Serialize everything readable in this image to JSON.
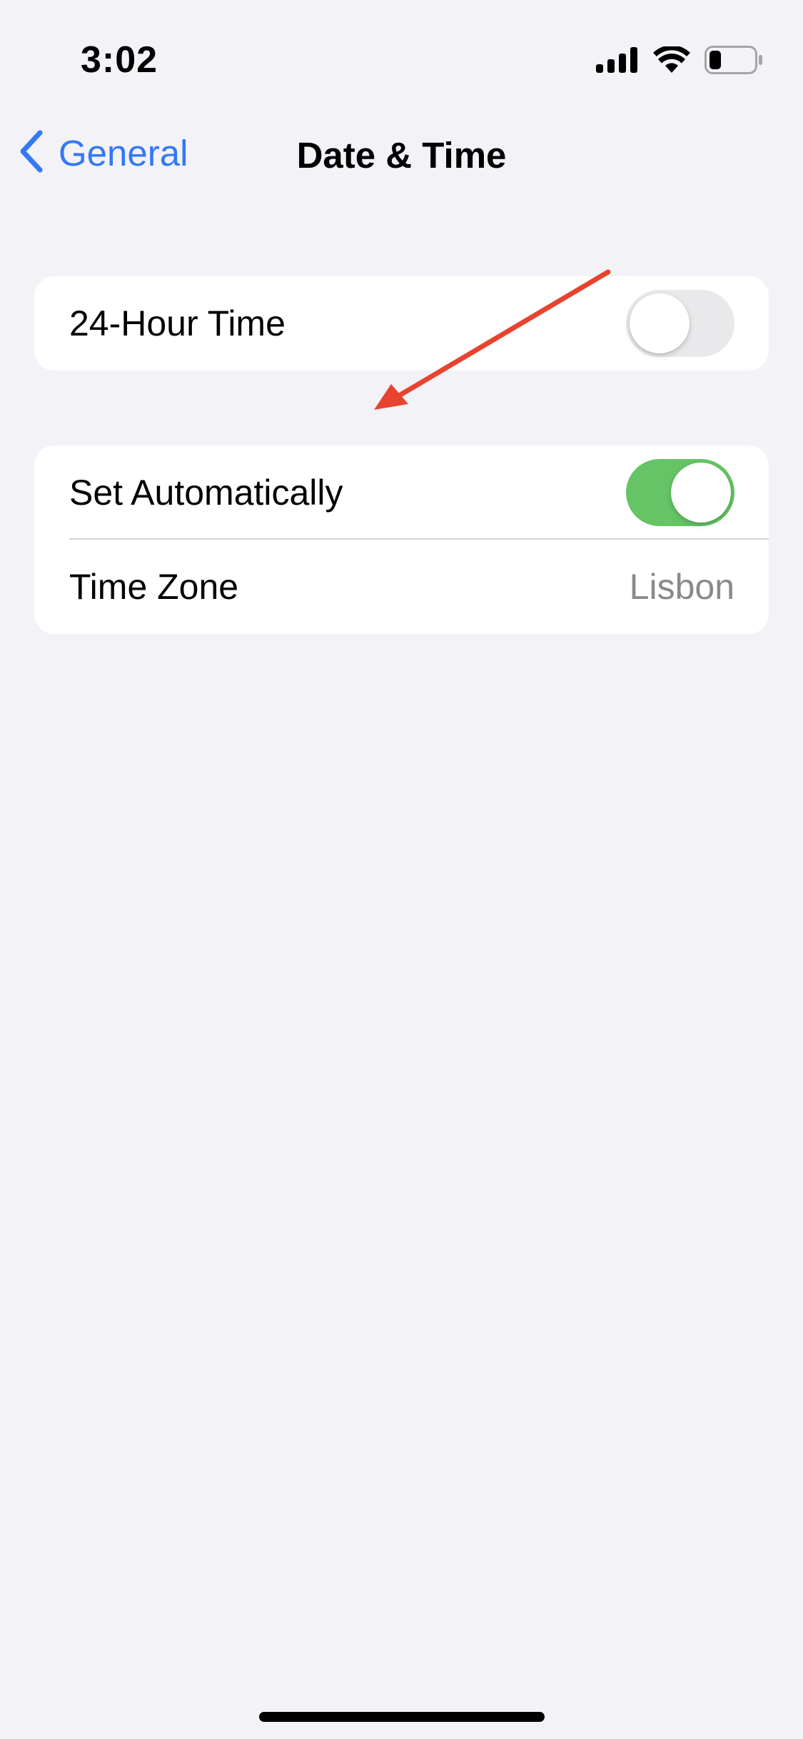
{
  "status_bar": {
    "time": "3:02",
    "icons": [
      "cellular-signal-icon",
      "wifi-icon",
      "battery-icon"
    ],
    "battery_level": 0.25
  },
  "nav": {
    "back_label": "General",
    "back_icon": "chevron-left-icon",
    "title": "Date & Time"
  },
  "settings": {
    "hour_24": {
      "label": "24-Hour Time",
      "enabled": false
    },
    "set_automatically": {
      "label": "Set Automatically",
      "enabled": true
    },
    "time_zone": {
      "label": "Time Zone",
      "value": "Lisbon"
    }
  },
  "annotation": {
    "type": "arrow",
    "color": "#E8432E"
  },
  "colors": {
    "accent": "#3478F6",
    "toggle_on": "#65C466",
    "toggle_off": "#E9E9EB",
    "background": "#F2F2F7",
    "secondary_text": "#8A8A8E"
  }
}
